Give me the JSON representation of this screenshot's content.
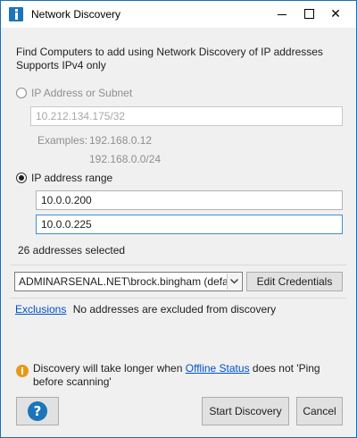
{
  "window": {
    "title": "Network Discovery",
    "controls": {
      "minimize_icon": "minimize-icon",
      "maximize_icon": "maximize-icon",
      "close_glyph": "✕"
    }
  },
  "intro": {
    "line1": "Find Computers to add using Network Discovery of IP addresses",
    "line2": "Supports IPv4 only"
  },
  "mode": {
    "subnet": {
      "label": "IP Address or Subnet",
      "selected": false,
      "value": "10.212.134.175/32",
      "examples_label": "Examples:",
      "example1": "192.168.0.12",
      "example2": "192.168.0.0/24"
    },
    "range": {
      "label": "IP address range",
      "selected": true,
      "start": "10.0.0.200",
      "end": "10.0.0.225",
      "count_text": "26 addresses selected"
    }
  },
  "credentials": {
    "selected": "ADMINARSENAL.NET\\brock.bingham (defa",
    "edit_label": "Edit Credentials"
  },
  "exclusions": {
    "link": "Exclusions",
    "text": "No addresses are excluded from discovery"
  },
  "notice": {
    "text_before": "Discovery will take longer when ",
    "link": "Offline Status",
    "text_after": " does not 'Ping",
    "line2": "before scanning'"
  },
  "footer": {
    "help_glyph": "?",
    "start_label": "Start Discovery",
    "cancel_label": "Cancel"
  },
  "colors": {
    "accent": "#1b75bb",
    "link": "#0050c8",
    "warning": "#e69a1a"
  }
}
